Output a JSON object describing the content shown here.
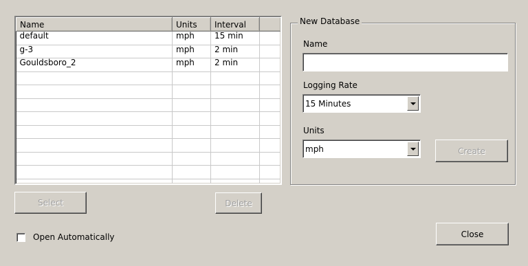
{
  "list": {
    "columns": [
      "Name",
      "Units",
      "Interval",
      ""
    ],
    "rows": [
      [
        "default",
        "mph",
        "15 min",
        ""
      ],
      [
        "g-3",
        "mph",
        "2 min",
        ""
      ],
      [
        "Gouldsboro_2",
        "mph",
        "2 min",
        ""
      ],
      [
        "",
        "",
        "",
        ""
      ],
      [
        "",
        "",
        "",
        ""
      ],
      [
        "",
        "",
        "",
        ""
      ],
      [
        "",
        "",
        "",
        ""
      ],
      [
        "",
        "",
        "",
        ""
      ],
      [
        "",
        "",
        "",
        ""
      ],
      [
        "",
        "",
        "",
        ""
      ],
      [
        "",
        "",
        "",
        ""
      ],
      [
        "",
        "",
        "",
        ""
      ]
    ]
  },
  "buttons": {
    "select": "Select",
    "delete": "Delete",
    "create": "Create",
    "close": "Close"
  },
  "new_database": {
    "legend": "New Database",
    "name_label": "Name",
    "name_value": "",
    "logging_rate_label": "Logging Rate",
    "logging_rate_value": "15 Minutes",
    "units_label": "Units",
    "units_value": "mph"
  },
  "open_automatically": {
    "label": "Open Automatically",
    "checked": false
  },
  "colors": {
    "background": "#d4d0c8",
    "disabled_text": "#a0a0a0"
  }
}
